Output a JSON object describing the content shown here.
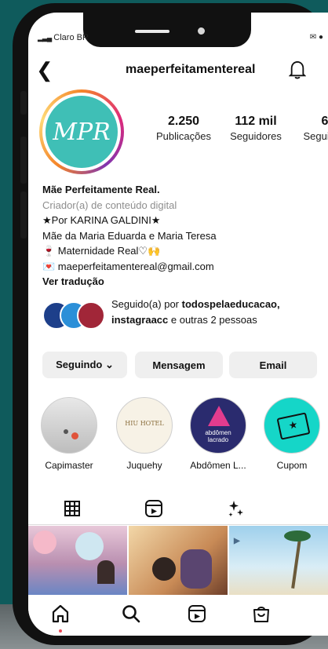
{
  "status": {
    "carrier": "Claro BR",
    "right": "✉ ●"
  },
  "header": {
    "username": "maeperfeitamentereal"
  },
  "profile": {
    "avatar_text": "MPR",
    "stats": [
      {
        "num": "2.250",
        "label": "Publicações"
      },
      {
        "num": "112 mil",
        "label": "Seguidores"
      },
      {
        "num": "6",
        "label": "Seguindo"
      }
    ]
  },
  "bio": {
    "name": "Mãe Perfeitamente Real.",
    "category": "Criador(a) de conteúdo digital",
    "lines": [
      "★Por KARINA GALDINI★",
      "Mãe da Maria Eduarda e Maria Teresa",
      "🍷 Maternidade Real♡🙌",
      "💌 maeperfeitamentereal@gmail.com"
    ],
    "translate": "Ver tradução"
  },
  "followed_by": {
    "prefix": "Seguido(a) por ",
    "account": "todospelaeducacao,",
    "line2_account": "instagraacc",
    "line2_suffix": " e outras 2 pessoas"
  },
  "actions": {
    "following": "Seguindo ⌄",
    "message": "Mensagem",
    "email": "Email"
  },
  "highlights": [
    {
      "label": "Capimaster"
    },
    {
      "label": "Juquehy",
      "inner": "HIU HOTEL"
    },
    {
      "label": "Abdômen L...",
      "inner": "abdômen\nlacrado"
    },
    {
      "label": "Cupom"
    }
  ],
  "colors": {
    "accent_background": "#0f5b5c",
    "notification_dot": "#ed4956",
    "button_bg": "#efefef"
  }
}
